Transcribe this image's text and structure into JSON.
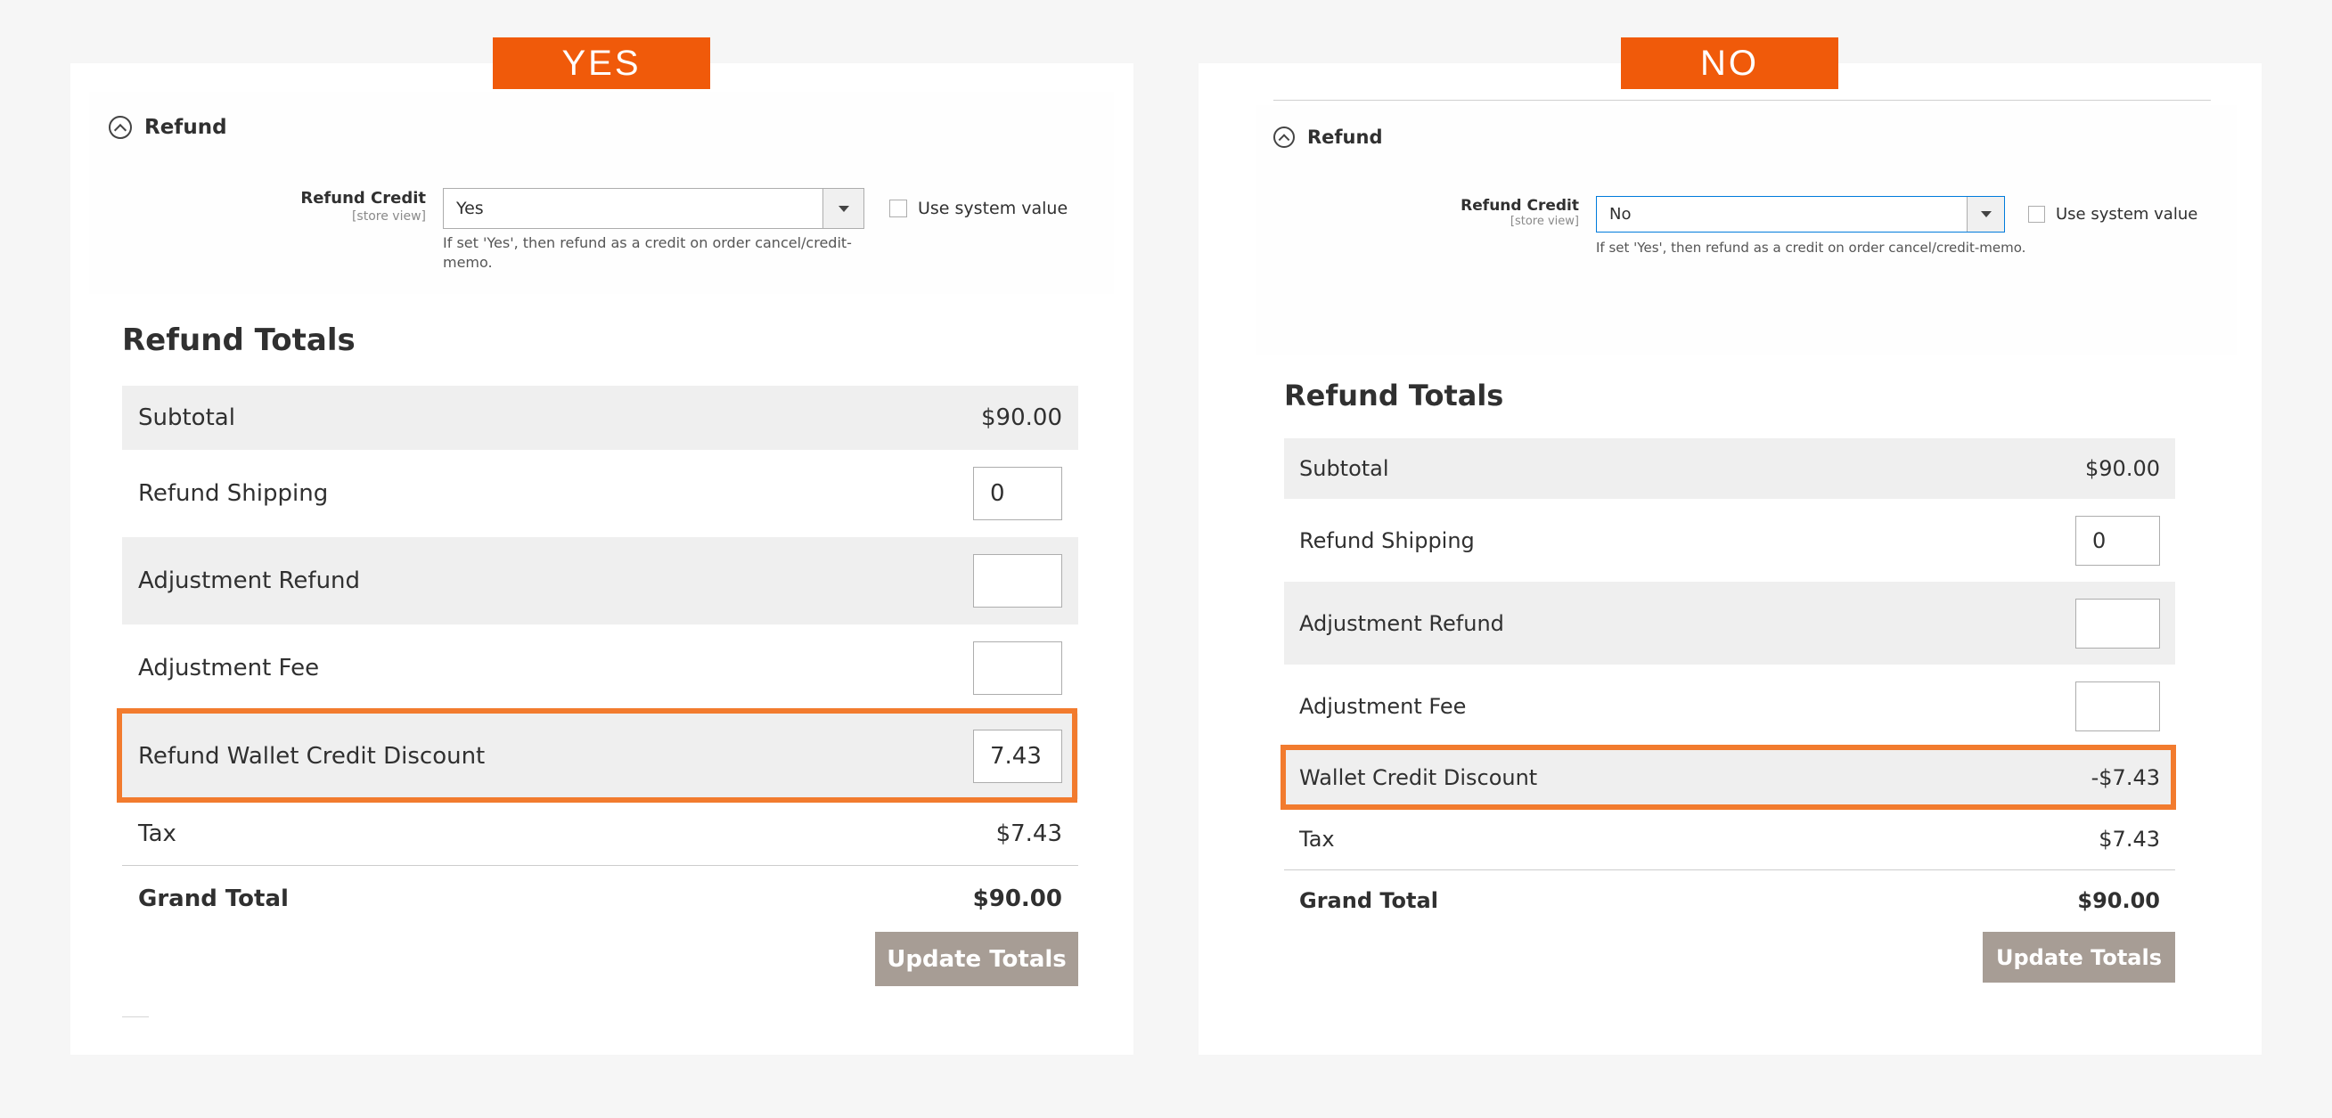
{
  "left": {
    "badge": "YES",
    "section_title": "Refund",
    "field_label": "Refund Credit",
    "field_scope": "[store view]",
    "select_value": "Yes",
    "use_system_value": "Use system value",
    "note_line1": "If set 'Yes', then refund as a credit on order cancel/credit-",
    "note_line2": "memo.",
    "totals_title": "Refund Totals",
    "subtotal_label": "Subtotal",
    "subtotal_value": "$90.00",
    "shipping_label": "Refund Shipping",
    "shipping_value": "0",
    "adj_refund_label": "Adjustment Refund",
    "adj_refund_value": "",
    "adj_fee_label": "Adjustment Fee",
    "adj_fee_value": "",
    "wallet_label": "Refund Wallet Credit Discount",
    "wallet_value": "7.43",
    "tax_label": "Tax",
    "tax_value": "$7.43",
    "grand_label": "Grand Total",
    "grand_value": "$90.00",
    "button": "Update Totals"
  },
  "right": {
    "badge": "NO",
    "section_title": "Refund",
    "field_label": "Refund Credit",
    "field_scope": "[store view]",
    "select_value": "No",
    "use_system_value": "Use system value",
    "note_line1": "If set 'Yes', then refund as a credit on order cancel/credit-memo.",
    "totals_title": "Refund Totals",
    "subtotal_label": "Subtotal",
    "subtotal_value": "$90.00",
    "shipping_label": "Refund Shipping",
    "shipping_value": "0",
    "adj_refund_label": "Adjustment Refund",
    "adj_refund_value": "",
    "adj_fee_label": "Adjustment Fee",
    "adj_fee_value": "",
    "wallet_label": "Wallet Credit Discount",
    "wallet_value": "-$7.43",
    "tax_label": "Tax",
    "tax_value": "$7.43",
    "grand_label": "Grand Total",
    "grand_value": "$90.00",
    "button": "Update Totals"
  },
  "colors": {
    "badge": "#f05a0a",
    "highlight": "#f27b2e",
    "button": "#a79d95",
    "row_shade": "#efefef",
    "page_bg": "#f6f6f6"
  }
}
